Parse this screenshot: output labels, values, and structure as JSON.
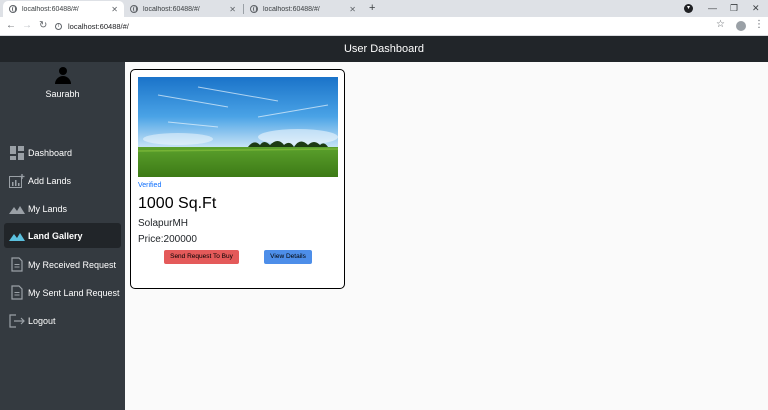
{
  "browser": {
    "tabs": [
      {
        "title": "localhost:60488/#/",
        "active": true
      },
      {
        "title": "localhost:60488/#/",
        "active": false
      },
      {
        "title": "localhost:60488/#/",
        "active": false
      }
    ],
    "url": "localhost:60488/#/"
  },
  "header": {
    "title": "User Dashboard"
  },
  "sidebar": {
    "username": "Saurabh",
    "items": [
      {
        "label": "Dashboard",
        "icon": "dashboard-icon",
        "active": false
      },
      {
        "label": "Add Lands",
        "icon": "add-chart-icon",
        "active": false
      },
      {
        "label": "My Lands",
        "icon": "mountain-icon",
        "active": false
      },
      {
        "label": "Land Gallery",
        "icon": "mountain-icon",
        "active": true
      },
      {
        "label": "My Received Request",
        "icon": "document-icon",
        "active": false
      },
      {
        "label": "My Sent Land Request",
        "icon": "document-icon",
        "active": false
      },
      {
        "label": "Logout",
        "icon": "logout-icon",
        "active": false
      }
    ]
  },
  "card": {
    "status": "Verified",
    "area": "1000 Sq.Ft",
    "location": "SolapurMH",
    "price": "Price:200000",
    "buy_label": "Send Request To Buy",
    "view_label": "View Details"
  },
  "colors": {
    "header_bg": "#212529",
    "sidebar_bg": "#343a40",
    "verified": "#0d6efd",
    "buy_button": "#e45a5a",
    "view_button": "#4d8ee9"
  }
}
